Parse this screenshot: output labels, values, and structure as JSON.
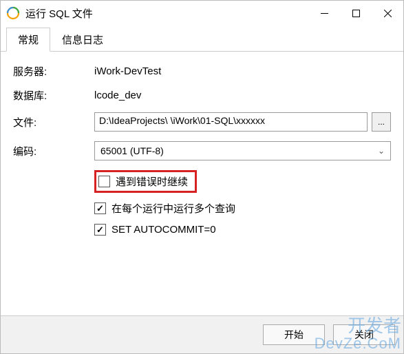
{
  "window": {
    "title": "运行 SQL 文件"
  },
  "tabs": {
    "general": "常规",
    "log": "信息日志"
  },
  "labels": {
    "server": "服务器:",
    "database": "数据库:",
    "file": "文件:",
    "encoding": "编码:"
  },
  "values": {
    "server": "iWork-DevTest",
    "database": "lcode_dev",
    "file_prefix": "D:\\IdeaProjects\\",
    "file_blurred": "   ",
    "file_suffix": "\\iWork\\01-SQL\\xxxxxx",
    "browse": "...",
    "encoding": "65001 (UTF-8)"
  },
  "options": {
    "continue_on_error": "遇到错误时继续",
    "multi_query": "在每个运行中运行多个查询",
    "autocommit": "SET AUTOCOMMIT=0"
  },
  "footer": {
    "start": "开始",
    "close": "关闭"
  },
  "watermark": {
    "line1": "开发者",
    "line2": "DevZe.CoM"
  }
}
